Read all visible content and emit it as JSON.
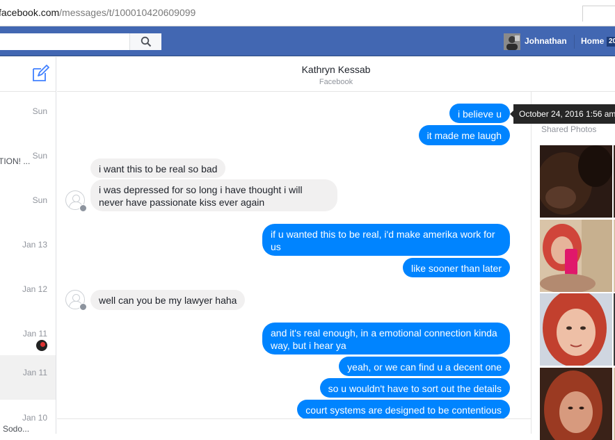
{
  "browser": {
    "url_host": "facebook.com",
    "url_path": "/messages/t/100010420609099"
  },
  "topbar": {
    "username": "Johnathan",
    "home_label": "Home",
    "home_count": "20"
  },
  "conversations": [
    {
      "date": "Sun",
      "snippet": ""
    },
    {
      "date": "Sun",
      "snippet": "TION! ..."
    },
    {
      "date": "Sun",
      "snippet": ""
    },
    {
      "date": "Jan 13",
      "snippet": ""
    },
    {
      "date": "Jan 12",
      "snippet": ""
    },
    {
      "date": "Jan 11",
      "snippet": ""
    },
    {
      "date": "Jan 11",
      "snippet": ""
    },
    {
      "date": "Jan 10",
      "snippet": "Sodo..."
    }
  ],
  "header": {
    "name": "Kathryn Kessab",
    "subtitle": "Facebook"
  },
  "messages": [
    {
      "dir": "out",
      "text": "i believe u"
    },
    {
      "dir": "out",
      "text": "it made me laugh"
    },
    {
      "dir": "in",
      "text": "i want this to be real so bad"
    },
    {
      "dir": "in",
      "text": "i was depressed for so long i have thought i will never have passionate kiss ever again"
    },
    {
      "dir": "out",
      "text": "if u wanted this to be real, i'd make amerika work for us"
    },
    {
      "dir": "out",
      "text": "like sooner than later"
    },
    {
      "dir": "in",
      "text": "well can you be my lawyer haha"
    },
    {
      "dir": "out",
      "text": "and it's real enough, in a emotional connection kinda way, but i hear ya"
    },
    {
      "dir": "out",
      "text": "yeah, or we can find u a decent one"
    },
    {
      "dir": "out",
      "text": "so u wouldn't have to sort out the details"
    },
    {
      "dir": "out",
      "text": "court systems are designed to be contentious"
    }
  ],
  "tooltip": {
    "text": "October 24, 2016 1:56 am"
  },
  "sidebar": {
    "shared_photos_title": "Shared Photos"
  },
  "colors": {
    "fb_blue": "#4267b2",
    "messenger_blue": "#0084ff",
    "incoming_gray": "#f1f0f0"
  }
}
